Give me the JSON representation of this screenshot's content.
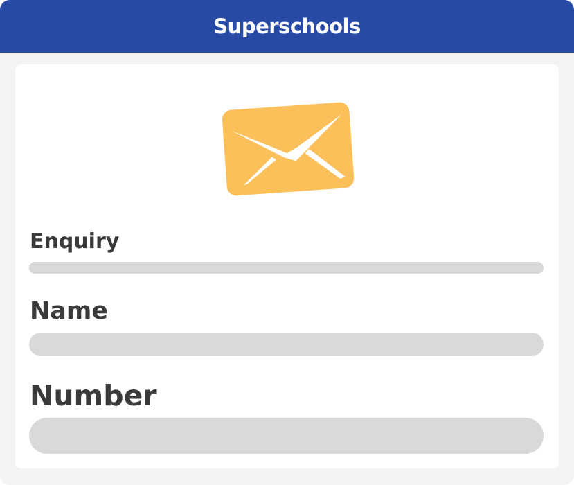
{
  "header": {
    "title": "Superschools"
  },
  "icons": {
    "envelope": "envelope-icon"
  },
  "colors": {
    "header_bg": "#274aa5",
    "envelope": "#fbc05a",
    "field_bg": "#d9d9d9",
    "label_text": "#3a3a3a",
    "frame_bg": "#f3f3f3"
  },
  "form": {
    "enquiry_label": "Enquiry",
    "name_label": "Name",
    "number_label": "Number"
  }
}
